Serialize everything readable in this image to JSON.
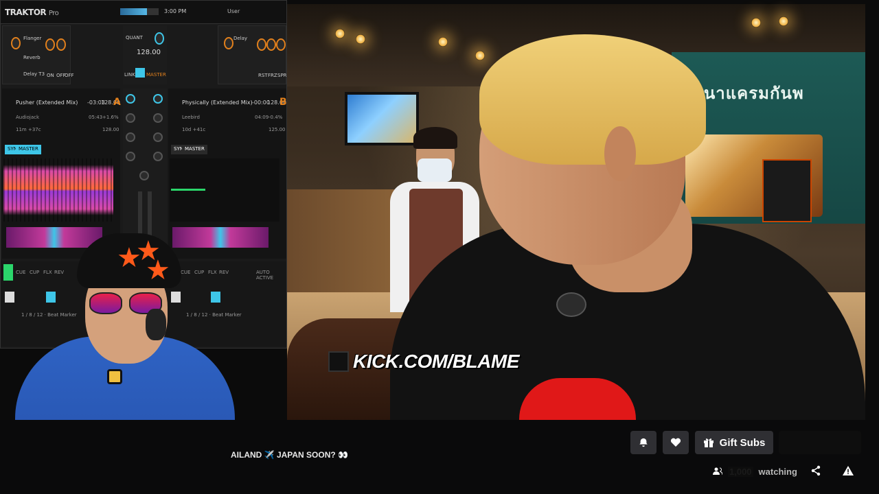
{
  "video": {
    "watermark_text": "KICK.COM/BLAME",
    "sign_text": "พนาแครมกันพ"
  },
  "traktor": {
    "logo": "TRAKTOR",
    "logo_suffix": "Pro",
    "time": "3:00 PM",
    "user": "User",
    "fx_left": [
      "Flanger",
      "Reverb",
      "Delay T3"
    ],
    "fx_left_buttons": [
      "ON",
      "OFF",
      "OFF"
    ],
    "fx_right": [
      "Delay"
    ],
    "fx_right_buttons": [
      "RST",
      "FRZ",
      "SPR"
    ],
    "tempo_label": "QUANT",
    "bpm": "128.00",
    "tempo_buttons": [
      "LINK",
      "AUTO",
      "MASTER"
    ],
    "deck_a": {
      "title": "Pusher (Extended Mix)",
      "artist": "Audiojack",
      "remaining": "-03:03",
      "bpm": "128.00",
      "key": "11m +37c",
      "pitch": "+1.6%",
      "elapsed": "05:43",
      "base_bpm": "128.00",
      "letter": "A",
      "tags": [
        "SYNC",
        "MASTER"
      ]
    },
    "deck_b": {
      "title": "Physically (Extended Mix)",
      "artist": "Leebird",
      "remaining": "-00:00",
      "bpm": "128.00",
      "key": "10d +41c",
      "pitch": "-0.4%",
      "elapsed": "04:09",
      "base_bpm": "125.00",
      "letter": "B",
      "tags": [
        "SYNC",
        "MASTER"
      ]
    },
    "transport_a": [
      "CUE",
      "CUP",
      "FLX",
      "REV"
    ],
    "transport_b": [
      "CUE",
      "CUP",
      "FLX",
      "REV"
    ],
    "beat_a": "1 / 8 / 12 · Beat Marker",
    "beat_b": "1 / 8 / 12 · Beat Marker",
    "auto_label": "AUTO ACTIVE"
  },
  "infobar": {
    "title_fragment": "AILAND ✈️ JAPAN SOON? 👀",
    "gift_label": "Gift Subs",
    "watching_count": "1,000",
    "watching_label": "watching"
  },
  "icons": {
    "bell": "bell-icon",
    "heart": "heart-icon",
    "gift": "gift-icon",
    "viewers": "viewers-icon",
    "share": "share-icon",
    "report": "report-icon"
  },
  "colors": {
    "traktor_accent": "#3ec6e8",
    "traktor_orange": "#e2801c",
    "button_bg": "#2f2f33",
    "background": "#0a0a0b"
  }
}
